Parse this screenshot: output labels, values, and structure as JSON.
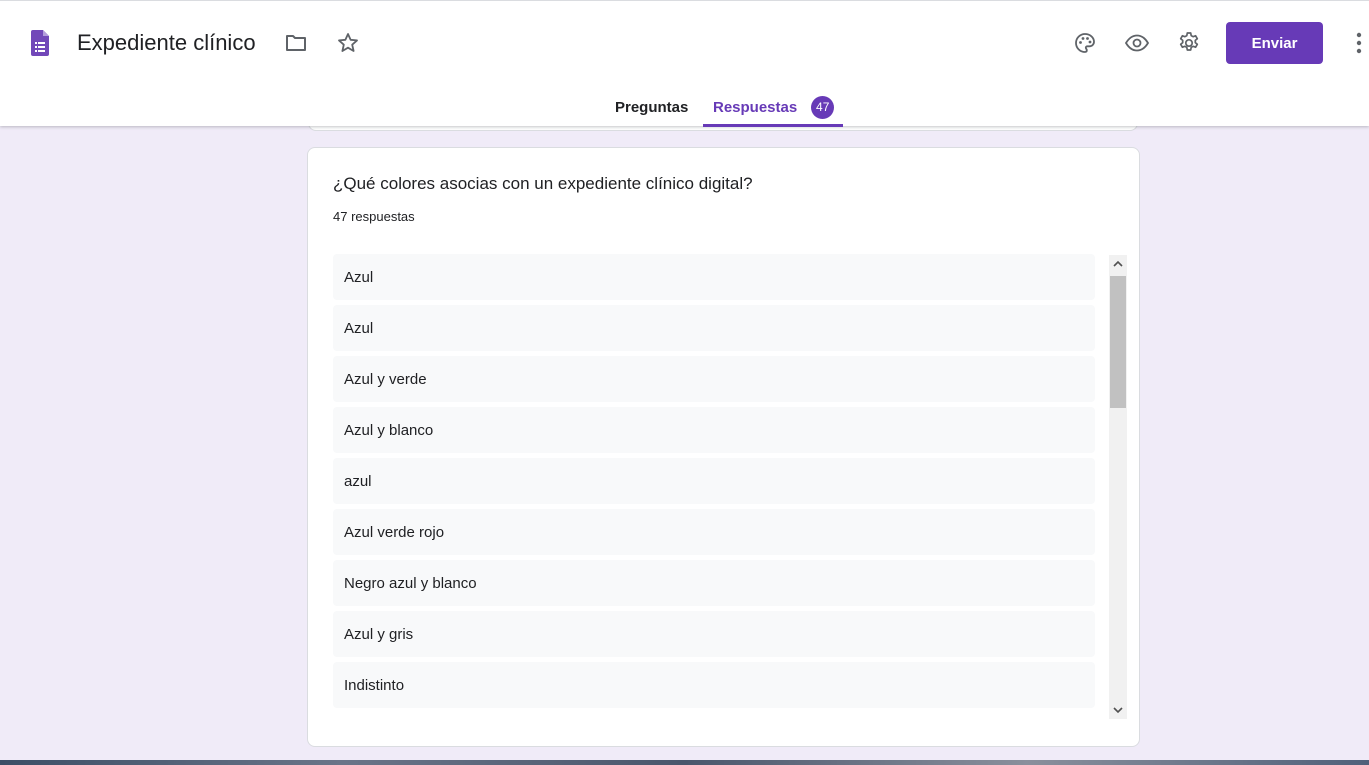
{
  "header": {
    "app_icon": "google-forms-icon",
    "title": "Expediente clínico",
    "icons": {
      "folder": "folder-icon",
      "star": "star-icon",
      "palette": "palette-icon",
      "preview": "eye-icon",
      "settings": "gear-icon",
      "more": "more-vert-icon"
    },
    "send_label": "Enviar",
    "accent_color": "#673ab7"
  },
  "tabs": [
    {
      "label": "Preguntas",
      "active": false
    },
    {
      "label": "Respuestas",
      "active": true,
      "badge": "47"
    }
  ],
  "question_card": {
    "question": "¿Qué colores asocias con un expediente clínico digital?",
    "response_count": "47 respuestas",
    "responses": [
      "Azul",
      "Azul",
      "Azul y verde",
      "Azul y blanco",
      "azul",
      "Azul verde rojo",
      "Negro azul y blanco",
      "Azul y gris",
      "Indistinto"
    ]
  },
  "colors": {
    "background": "#f0ebf8",
    "primary": "#673ab7",
    "response_bg": "#f8f9fa"
  }
}
